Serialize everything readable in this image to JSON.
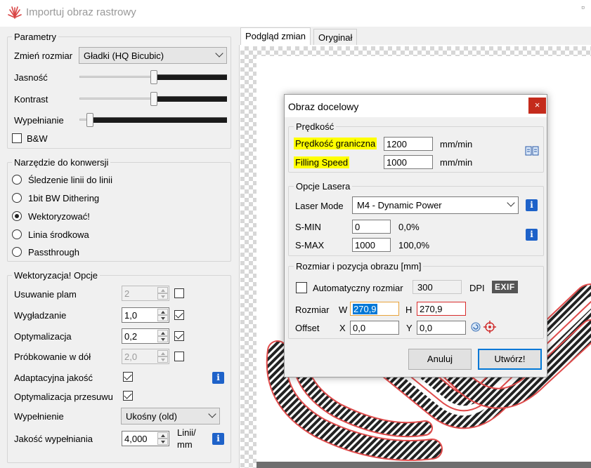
{
  "window": {
    "title": "Importuj obraz rastrowy"
  },
  "params": {
    "legend": "Parametry",
    "resize_label": "Zmień rozmiar",
    "resize_value": "Gładki (HQ Bicubic)",
    "brightness_label": "Jasność",
    "contrast_label": "Kontrast",
    "fill_label": "Wypełnianie",
    "bw_label": "B&W"
  },
  "tool": {
    "legend": "Narzędzie do konwersji",
    "options": [
      "Śledzenie linii do linii",
      "1bit BW Dithering",
      "Wektoryzować!",
      "Linia środkowa",
      "Passthrough"
    ],
    "selected": "Wektoryzować!"
  },
  "vector": {
    "legend": "Wektoryzacja! Opcje",
    "spot_removal_label": "Usuwanie plam",
    "spot_removal_value": "2",
    "smoothing_label": "Wygładzanie",
    "smoothing_value": "1,0",
    "optimization_label": "Optymalizacja",
    "optimization_value": "0,2",
    "downsample_label": "Próbkowanie w dół",
    "downsample_value": "2,0",
    "adaptive_label": "Adaptacyjna jakość",
    "shift_opt_label": "Optymalizacja przesuwu",
    "fill_label": "Wypełnienie",
    "fill_value": "Ukośny (old)",
    "fill_quality_label": "Jakość wypełniania",
    "fill_quality_value": "4,000",
    "fill_quality_unit_1": "Linii/",
    "fill_quality_unit_2": "mm"
  },
  "tabs": [
    "Podgląd zmian",
    "Oryginał"
  ],
  "dialog": {
    "title": "Obraz docelowy",
    "close": "×",
    "speed_legend": "Prędkość",
    "border_speed_label": "Prędkość graniczna",
    "border_speed_value": "1200",
    "filling_speed_label": "Filling Speed",
    "filling_speed_value": "1000",
    "speed_unit": "mm/min",
    "laser_legend": "Opcje Lasera",
    "laser_mode_label": "Laser Mode",
    "laser_mode_value": "M4 - Dynamic Power",
    "smin_label": "S-MIN",
    "smin_value": "0",
    "smin_percent": "0,0%",
    "smax_label": "S-MAX",
    "smax_value": "1000",
    "smax_percent": "100,0%",
    "size_legend": "Rozmiar i pozycja obrazu [mm]",
    "auto_size_label": "Automatyczny rozmiar",
    "dpi_value": "300",
    "dpi_label": "DPI",
    "exif_label": "EXIF",
    "size_label": "Rozmiar",
    "w_label": "W",
    "w_value": "270,9",
    "h_label": "H",
    "h_value": "270,9",
    "offset_label": "Offset",
    "x_label": "X",
    "x_value": "0,0",
    "y_label": "Y",
    "y_value": "0,0",
    "cancel_label": "Anuluj",
    "create_label": "Utwórz!"
  },
  "info_glyph": "i",
  "colors": {
    "accent": "#1e62c9",
    "close": "#c42b1c",
    "highlight": "#ffff00"
  }
}
